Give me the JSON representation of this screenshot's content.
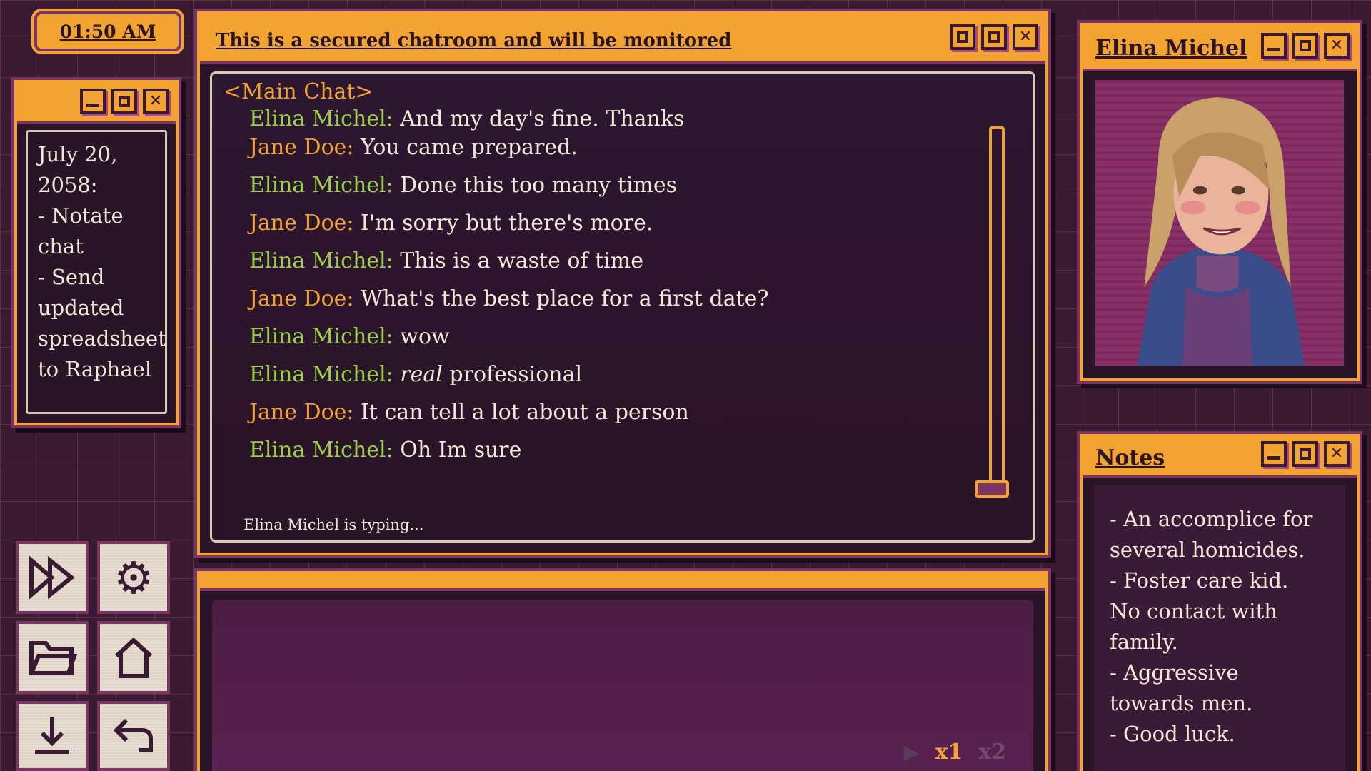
{
  "clock": {
    "time": "01:50 AM"
  },
  "todo": {
    "lines": [
      "July 20,",
      "2058:",
      "- Notate",
      "chat",
      "- Send",
      "updated",
      "spreadsheet",
      "to Raphael"
    ]
  },
  "chat": {
    "title": "This is a secured chatroom and will be monitored",
    "channel": "<Main Chat>",
    "messages": [
      {
        "who": "Elina Michel:",
        "text": "And my day's fine. Thanks"
      },
      {
        "who": "Jane Doe:",
        "text": "You came prepared."
      },
      {
        "who": "Elina Michel:",
        "text": "Done this too many times"
      },
      {
        "who": "Jane Doe:",
        "text": "I'm sorry but there's more."
      },
      {
        "who": "Elina Michel:",
        "text": "This is a waste of time"
      },
      {
        "who": "Jane Doe:",
        "text": "What's the best place for a first date?"
      },
      {
        "who": "Elina Michel:",
        "text": "wow"
      },
      {
        "who": "Elina Michel:",
        "em": "real",
        "text": " professional"
      },
      {
        "who": "Jane Doe:",
        "text": "It can tell a lot about a person"
      },
      {
        "who": "Elina Michel:",
        "text": "Oh Im sure"
      }
    ],
    "typing": "Elina Michel is typing..."
  },
  "speed": {
    "play_icon": "▶",
    "x1": "x1",
    "x2": "x2"
  },
  "tools": {
    "fast_forward_icon": "fast-forward-icon",
    "settings_icon": "gear-icon",
    "load_icon": "folder-icon",
    "home_icon": "home-icon",
    "save_icon": "download-icon",
    "back_icon": "undo-icon"
  },
  "portrait": {
    "name": "Elina Michel"
  },
  "notes": {
    "title": "Notes",
    "lines": [
      "- An accomplice for",
      "several homicides.",
      "- Foster care kid.",
      "No contact with",
      "family.",
      "- Aggressive",
      "towards men.",
      "- Good luck."
    ]
  },
  "colors": {
    "accent": "#f2a332",
    "jane": "#f2a332",
    "elina": "#9bd14a",
    "frame": "#7a3565",
    "bg": "#2a1428"
  }
}
